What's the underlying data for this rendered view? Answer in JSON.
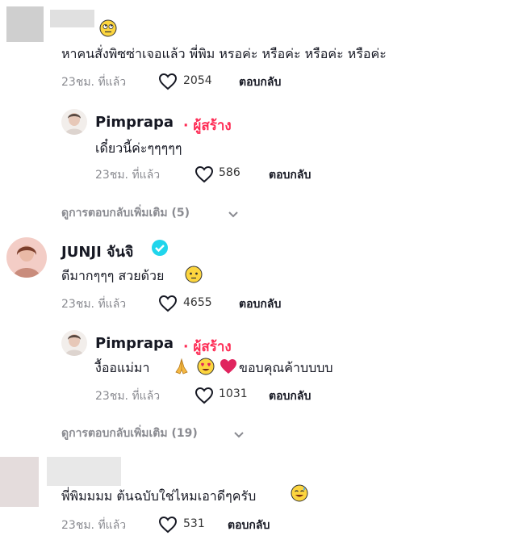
{
  "comments": [
    {
      "text": "หาคนสั่งพิซซ่าเจอแล้ว พี่พิม หรอค่ะ หรือค่ะ หรือค่ะ หรือค่ะ",
      "time": "23ชม. ที่แล้ว",
      "likes": "2054",
      "reply_label": "ตอบกลับ",
      "reply": {
        "name": "Pimprapa",
        "badge": "· ผู้สร้าง",
        "text": "เดี๋ยวนี้ค่ะๆๆๆๆๆ",
        "time": "23ชม. ที่แล้ว",
        "likes": "586",
        "reply_label": "ตอบกลับ"
      },
      "more_replies": "ดูการตอบกลับเพิ่มเติม (5)"
    },
    {
      "name": "JUNJI จันจิ",
      "text": "ดีมากๆๆๆ สวยด้วย",
      "time": "23ชม. ที่แล้ว",
      "likes": "4655",
      "reply_label": "ตอบกลับ",
      "reply": {
        "name": "Pimprapa",
        "badge": "· ผู้สร้าง",
        "text": "งื้ออแม่มา",
        "text_after": "ขอบคุณค้าบบบบ",
        "time": "23ชม. ที่แล้ว",
        "likes": "1031",
        "reply_label": "ตอบกลับ"
      },
      "more_replies": "ดูการตอบกลับเพิ่มเติม (19)"
    },
    {
      "text": "พี่พิมมมม ต้นฉบับใช่ไหมเอาดีๆครับ",
      "time": "23ชม. ที่แล้ว",
      "likes": "531",
      "reply_label": "ตอบกลับ"
    }
  ],
  "colors": {
    "creator": "#fe2c55",
    "verified": "#20d5ec",
    "meta": "#8a8b91"
  }
}
